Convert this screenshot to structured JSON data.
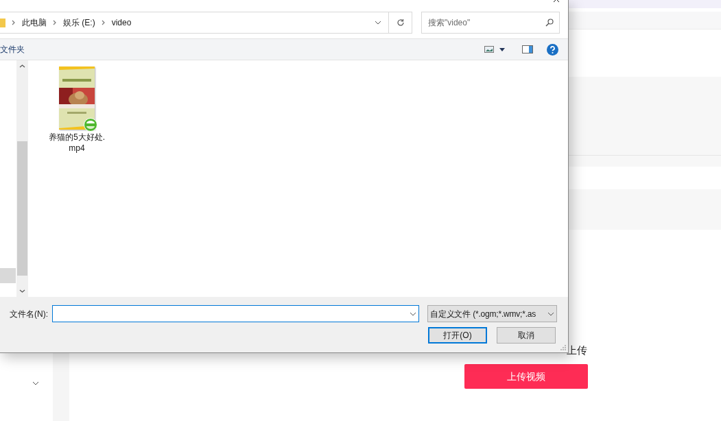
{
  "dialog": {
    "address_bar": {
      "crumbs": [
        "此电脑",
        "娱乐 (E:)",
        "video"
      ]
    },
    "search": {
      "placeholder": "搜索\"video\""
    },
    "toolbar": {
      "new_folder": "文件夹"
    },
    "nav_pane": {
      "items": [
        {
          "selected": true
        }
      ]
    },
    "files": [
      {
        "name": "养猫的5大好处.mp4",
        "kind": "picture",
        "selected": false
      }
    ],
    "filename": {
      "label": "文件名(N):"
    },
    "file_type": "自定义文件 (*.ogm;*.wmv;*.as",
    "buttons": [
      {
        "label": "打开(O)",
        "default": true
      },
      {
        "label": "取消",
        "default": false
      }
    ]
  },
  "page": {
    "hint": "上传",
    "upload_button": "上传视频"
  }
}
